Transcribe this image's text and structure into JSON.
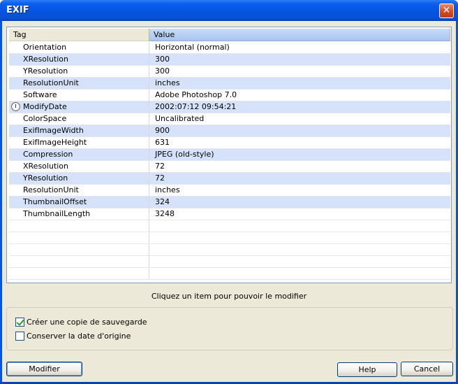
{
  "window": {
    "title": "EXIF",
    "close_glyph": "✕"
  },
  "grid": {
    "headers": {
      "tag": "Tag",
      "value": "Value"
    },
    "rows": [
      {
        "tag": "Orientation",
        "value": "Horizontal (normal)"
      },
      {
        "tag": "XResolution",
        "value": "300"
      },
      {
        "tag": "YResolution",
        "value": "300"
      },
      {
        "tag": "ResolutionUnit",
        "value": "inches"
      },
      {
        "tag": "Software",
        "value": "Adobe Photoshop 7.0"
      },
      {
        "tag": "ModifyDate",
        "value": "2002:07:12 09:54:21",
        "icon": "clock-icon"
      },
      {
        "tag": "ColorSpace",
        "value": "Uncalibrated"
      },
      {
        "tag": "ExifImageWidth",
        "value": "900"
      },
      {
        "tag": "ExifImageHeight",
        "value": "631"
      },
      {
        "tag": "Compression",
        "value": "JPEG (old-style)"
      },
      {
        "tag": "XResolution",
        "value": "72"
      },
      {
        "tag": "YResolution",
        "value": "72"
      },
      {
        "tag": "ResolutionUnit",
        "value": "inches"
      },
      {
        "tag": "ThumbnailOffset",
        "value": "324"
      },
      {
        "tag": "ThumbnailLength",
        "value": "3248"
      }
    ]
  },
  "hint": "Cliquez un item pour pouvoir le modifier",
  "options": {
    "backup": {
      "label": "Créer une copie de sauvegarde",
      "checked": true
    },
    "keep_date": {
      "label": "Conserver la date d'origine",
      "checked": false
    }
  },
  "buttons": {
    "modify": "Modifier",
    "help": "Help",
    "cancel": "Cancel"
  }
}
